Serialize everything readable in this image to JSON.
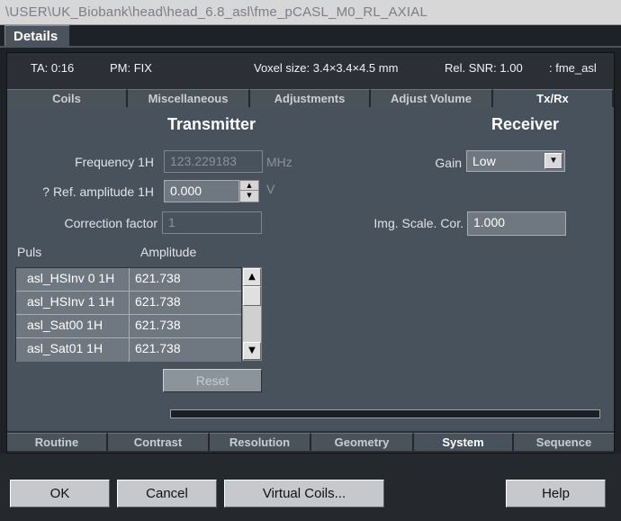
{
  "window": {
    "title": "\\USER\\UK_Biobank\\head\\head_6.8_asl\\fme_pCASL_M0_RL_AXIAL"
  },
  "details_tab": "Details",
  "info": {
    "ta": "TA: 0:16",
    "pm": "PM: FIX",
    "voxel": "Voxel size: 3.4×3.4×4.5 mm",
    "snr": "Rel. SNR: 1.00",
    "seq": ": fme_asl"
  },
  "top_tabs": [
    "Coils",
    "Miscellaneous",
    "Adjustments",
    "Adjust Volume",
    "Tx/Rx"
  ],
  "bottom_tabs": [
    "Routine",
    "Contrast",
    "Resolution",
    "Geometry",
    "System",
    "Sequence"
  ],
  "transmitter": {
    "heading": "Transmitter",
    "frequency_label": "Frequency 1H",
    "frequency_value": "123.229183",
    "frequency_unit": "MHz",
    "refamp_label": "? Ref. amplitude 1H",
    "refamp_value": "0.000",
    "refamp_unit": "V",
    "correction_label": "Correction factor",
    "correction_value": "1",
    "table_col_puls": "Puls",
    "table_col_amp": "Amplitude",
    "rows": [
      {
        "puls": "asl_HSInv 0 1H",
        "amp": "621.738"
      },
      {
        "puls": "asl_HSInv 1 1H",
        "amp": "621.738"
      },
      {
        "puls": "asl_Sat00 1H",
        "amp": "621.738"
      },
      {
        "puls": "asl_Sat01 1H",
        "amp": "621.738"
      }
    ],
    "reset_label": "Reset"
  },
  "receiver": {
    "heading": "Receiver",
    "gain_label": "Gain",
    "gain_value": "Low",
    "imgscale_label": "Img. Scale. Cor.",
    "imgscale_value": "1.000"
  },
  "buttons": {
    "ok": "OK",
    "cancel": "Cancel",
    "virtual_coils": "Virtual Coils...",
    "help": "Help"
  }
}
